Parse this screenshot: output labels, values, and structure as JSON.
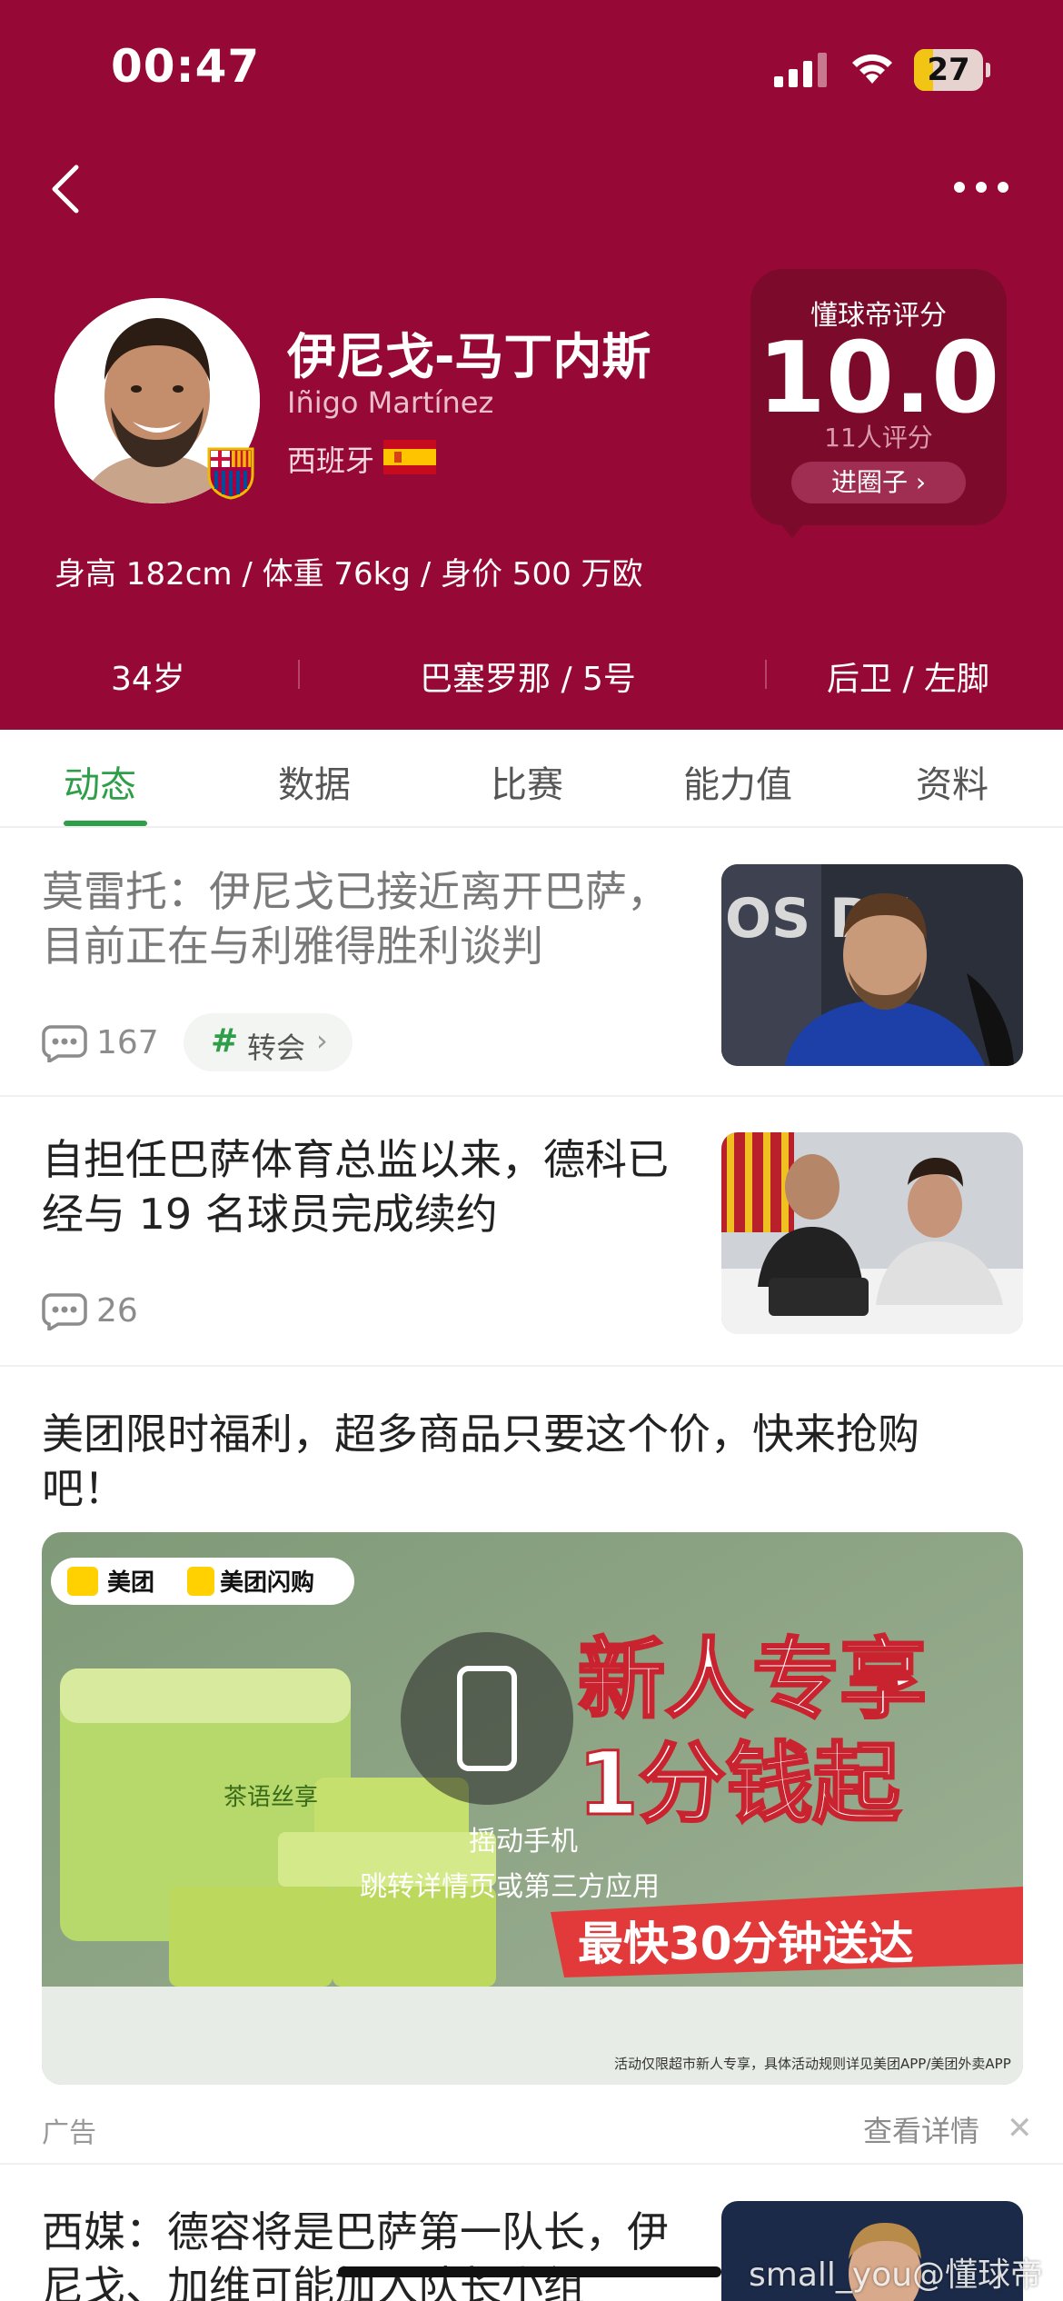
{
  "status_bar": {
    "time": "00:47",
    "battery": "27",
    "battery_level": 0.27
  },
  "player": {
    "name": "伊尼戈-马丁内斯",
    "latin_name": "Iñigo Martínez",
    "nationality": "西班牙",
    "physical": "身高 182cm / 体重 76kg / 身价 500 万欧",
    "age": "34岁",
    "club_number": "巴塞罗那 / 5号",
    "position_foot": "后卫 / 左脚"
  },
  "rating": {
    "title": "懂球帝评分",
    "score": "10.0",
    "count": "11人评分",
    "button": "进圈子 ›"
  },
  "tabs": [
    {
      "label": "动态",
      "active": true
    },
    {
      "label": "数据",
      "active": false
    },
    {
      "label": "比赛",
      "active": false
    },
    {
      "label": "能力值",
      "active": false
    },
    {
      "label": "资料",
      "active": false
    }
  ],
  "news": [
    {
      "title": "莫雷托：伊尼戈已接近离开巴萨，目前正在与利雅得胜利谈判",
      "comments": "167",
      "topic_hash": "#",
      "topic": "转会",
      "topic_arrow": "›",
      "read": true
    },
    {
      "title": "自担任巴萨体育总监以来，德科已经与 19 名球员完成续约",
      "comments": "26",
      "read": false
    },
    {
      "title": "西媒：德容将是巴萨第一队长，伊尼戈、加维可能加入队长小组",
      "read": false
    }
  ],
  "ad": {
    "title": "美团限时福利，超多商品只要这个价，快来抢购吧！",
    "brand_1": "美团",
    "brand_2": "美团闪购",
    "headline_1": "新人专享",
    "headline_2": "1分钱起",
    "shake_1": "摇动手机",
    "shake_2": "跳转详情页或第三方应用",
    "delivery": "最快30分钟送达",
    "fine_print": "活动仅限超市新人专享，具体活动规则详见美团APP/美团外卖APP",
    "tissue_text": "茶语丝享",
    "label": "广告",
    "detail": "查看详情",
    "close": "✕"
  },
  "watermark": "small_you@懂球帝",
  "colors": {
    "header_bg": "#960836",
    "accent_green": "#2e9e48",
    "rating_card": "#7c0a2a"
  },
  "icons": [
    "back-arrow-icon",
    "more-dots-icon",
    "signal-icon",
    "wifi-icon",
    "battery-icon",
    "comment-icon",
    "spain-flag-icon",
    "barcelona-badge-icon",
    "phone-shake-icon",
    "close-icon"
  ]
}
